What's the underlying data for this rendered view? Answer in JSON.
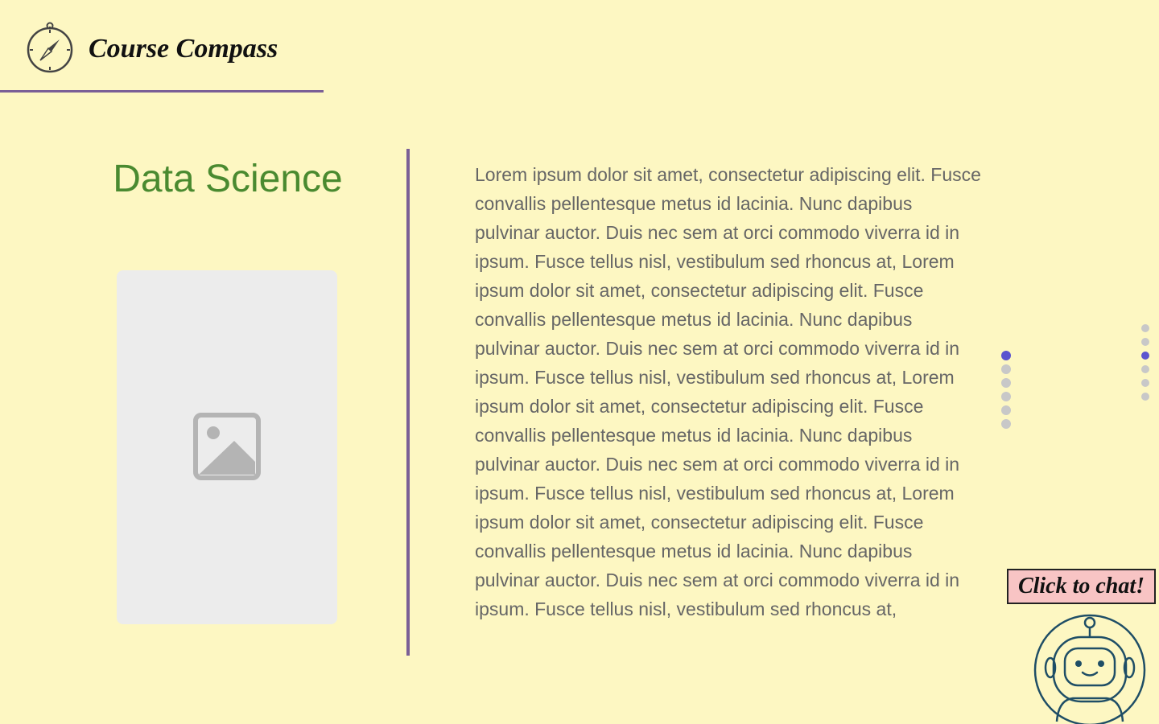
{
  "header": {
    "brand": "Course Compass",
    "logo_icon": "compass-icon"
  },
  "course": {
    "title": "Data Science",
    "image_icon": "image-placeholder-icon",
    "description": "Lorem ipsum dolor sit amet, consectetur adipiscing elit. Fusce convallis pellentesque metus id lacinia. Nunc dapibus pulvinar auctor. Duis nec sem at orci commodo viverra id in ipsum. Fusce tellus nisl, vestibulum sed rhoncus at, Lorem ipsum dolor sit amet, consectetur adipiscing elit. Fusce convallis pellentesque metus id lacinia. Nunc dapibus pulvinar auctor. Duis nec sem at orci commodo viverra id in ipsum. Fusce tellus nisl, vestibulum sed rhoncus at, Lorem ipsum dolor sit amet, consectetur adipiscing elit. Fusce convallis pellentesque metus id lacinia. Nunc dapibus pulvinar auctor. Duis nec sem at orci commodo viverra id in ipsum. Fusce tellus nisl, vestibulum sed rhoncus at, Lorem ipsum dolor sit amet, consectetur adipiscing elit. Fusce convallis pellentesque metus id lacinia. Nunc dapibus pulvinar auctor. Duis nec sem at orci commodo viverra id in ipsum. Fusce tellus nisl, vestibulum sed rhoncus at,"
  },
  "pagination": {
    "total": 6,
    "active_index": 0
  },
  "edge_pagination": {
    "total": 6,
    "active_index": 2
  },
  "chat": {
    "label": "Click to chat!",
    "icon": "robot-icon"
  },
  "colors": {
    "background": "#fdf7c2",
    "accent_purple": "#7a5f96",
    "title_green": "#4a8a30",
    "active_dot": "#5b54cf",
    "chat_label_bg": "#f8c4c4",
    "robot_stroke": "#1f4e66"
  }
}
